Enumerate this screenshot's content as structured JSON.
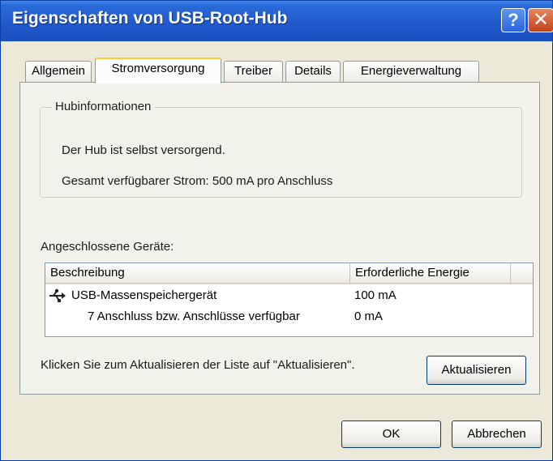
{
  "window": {
    "title": "Eigenschaften von USB-Root-Hub"
  },
  "titlebar": {
    "help_label": "?",
    "close_label": "✕"
  },
  "tabs": [
    {
      "label": "Allgemein",
      "active": false
    },
    {
      "label": "Stromversorgung",
      "active": true
    },
    {
      "label": "Treiber",
      "active": false
    },
    {
      "label": "Details",
      "active": false
    },
    {
      "label": "Energieverwaltung",
      "active": false
    }
  ],
  "hub_info": {
    "legend": "Hubinformationen",
    "line1": "Der Hub ist selbst versorgend.",
    "line2": "Gesamt verfügbarer Strom: 500 mA pro Anschluss"
  },
  "devices": {
    "label": "Angeschlossene Geräte:",
    "columns": [
      "Beschreibung",
      "Erforderliche Energie"
    ],
    "rows": [
      {
        "description": "USB-Massenspeichergerät",
        "power": "100 mA",
        "icon": "usb-icon"
      },
      {
        "description": "7 Anschluss bzw. Anschlüsse verfügbar",
        "power": "0 mA"
      }
    ]
  },
  "refresh": {
    "hint": "Klicken Sie zum Aktualisieren der Liste auf \"Aktualisieren\".",
    "button_label": "Aktualisieren"
  },
  "footer": {
    "ok_label": "OK",
    "cancel_label": "Abbrechen"
  }
}
